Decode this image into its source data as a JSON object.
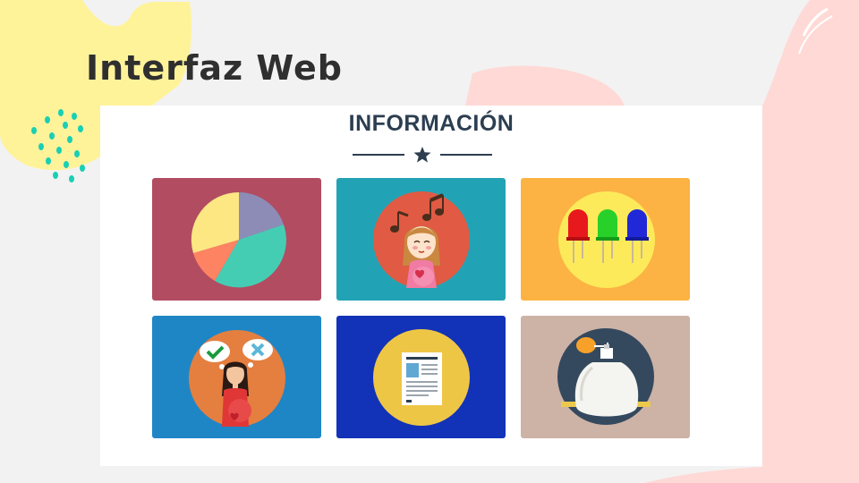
{
  "slide": {
    "title": "Interfaz Web"
  },
  "panel": {
    "heading": "INFORMACIÓN"
  },
  "cards": [
    {
      "name": "statistics-chart-card",
      "icon": "pie-chart-icon",
      "color": "#b24c61"
    },
    {
      "name": "music-pregnancy-card",
      "icon": "pregnant-girl-music-icon",
      "color": "#22a3b5"
    },
    {
      "name": "traffic-lights-card",
      "icon": "colored-leds-icon",
      "color": "#fcb343"
    },
    {
      "name": "pregnancy-decisions-card",
      "icon": "pregnant-woman-check-cross-icon",
      "color": "#1f86c6"
    },
    {
      "name": "document-card",
      "icon": "document-icon",
      "color": "#1233b7"
    },
    {
      "name": "perfume-card",
      "icon": "perfume-bottle-icon",
      "color": "#cdb2a6"
    }
  ],
  "colors": {
    "background": "#f2f2f2",
    "heading": "#2c3e50",
    "title": "#2f2f2f",
    "accent_yellow": "#fff39a",
    "accent_pink": "#ffd5d5",
    "dots": "#19cfb4"
  }
}
